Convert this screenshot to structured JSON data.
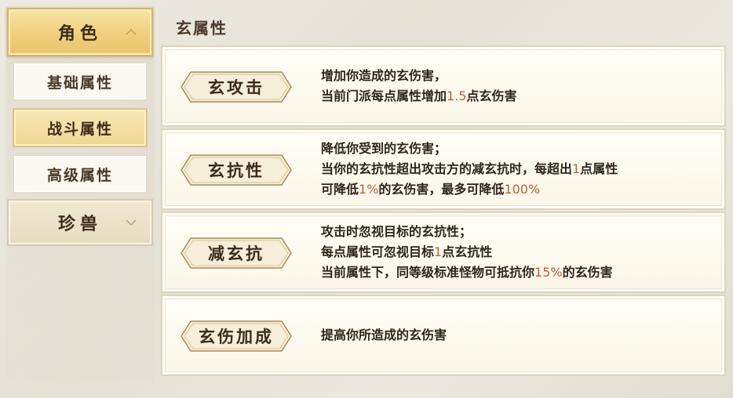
{
  "sidebar": {
    "category_role": "角色",
    "items": [
      {
        "label": "基础属性"
      },
      {
        "label": "战斗属性"
      },
      {
        "label": "高级属性"
      }
    ],
    "category_beast": "珍兽",
    "active_item": "战斗属性"
  },
  "section_title": "玄属性",
  "rows": [
    {
      "tag": "玄攻击",
      "lines": [
        {
          "a": "增加你造成的玄伤害，",
          "n": "",
          "b": ""
        },
        {
          "a": "当前门派每点属性增加",
          "n": "1.5",
          "b": "点玄伤害"
        }
      ]
    },
    {
      "tag": "玄抗性",
      "lines": [
        {
          "a": "降低你受到的玄伤害；",
          "n": "",
          "b": "",
          "n2": "",
          "b2": ""
        },
        {
          "a": "当你的玄抗性超出攻击方的减玄抗时，每超出",
          "n": "1",
          "b": "点属性",
          "n2": "",
          "b2": ""
        },
        {
          "a": "可降低",
          "n": "1%",
          "b": "的玄伤害，最多可降低",
          "n2": "100%",
          "b2": ""
        }
      ]
    },
    {
      "tag": "减玄抗",
      "lines": [
        {
          "a": "攻击时忽视目标的玄抗性；",
          "n": "",
          "b": ""
        },
        {
          "a": "每点属性可忽视目标",
          "n": "1",
          "b": "点玄抗性"
        },
        {
          "a": "当前属性下，同等级标准怪物可抵抗你",
          "n": "15%",
          "b": "的玄伤害"
        }
      ]
    },
    {
      "tag": "玄伤加成",
      "lines": [
        {
          "a": "提高你所造成的玄伤害",
          "n": "",
          "b": ""
        }
      ]
    }
  ],
  "colors": {
    "accent_number": "#b5643a",
    "active_tab": "#efcf7d",
    "tag_fill": "#f6eed8",
    "tag_border": "#a88a55"
  },
  "icons": {
    "collapse": "chevron-up-icon",
    "expand": "chevron-down-icon"
  }
}
